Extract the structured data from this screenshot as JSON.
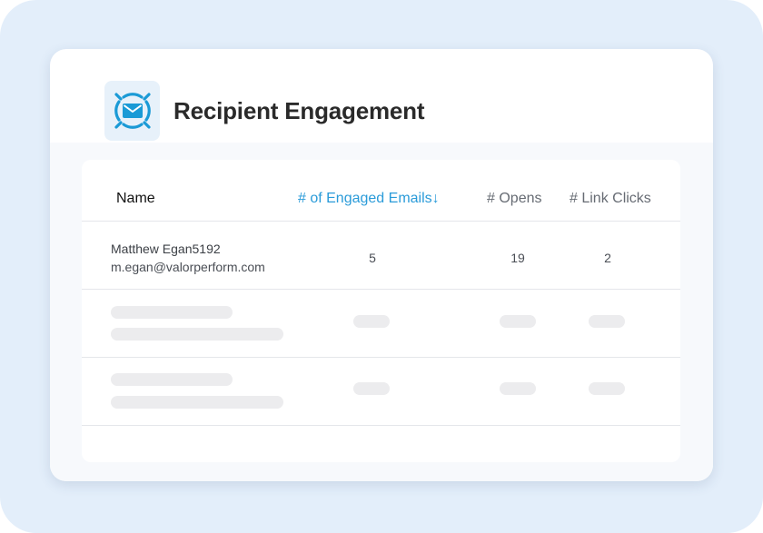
{
  "header": {
    "title": "Recipient Engagement",
    "icon": "email-target-icon",
    "accent_color": "#2a9bd9"
  },
  "table": {
    "columns": {
      "name": "Name",
      "engaged_emails": "# of Engaged Emails",
      "sort_indicator": "↓",
      "opens": "# Opens",
      "link_clicks": "# Link Clicks"
    },
    "rows": [
      {
        "name": "Matthew Egan5192",
        "email": "m.egan@valorperform.com",
        "engaged_emails": "5",
        "opens": "19",
        "link_clicks": "2"
      }
    ]
  }
}
